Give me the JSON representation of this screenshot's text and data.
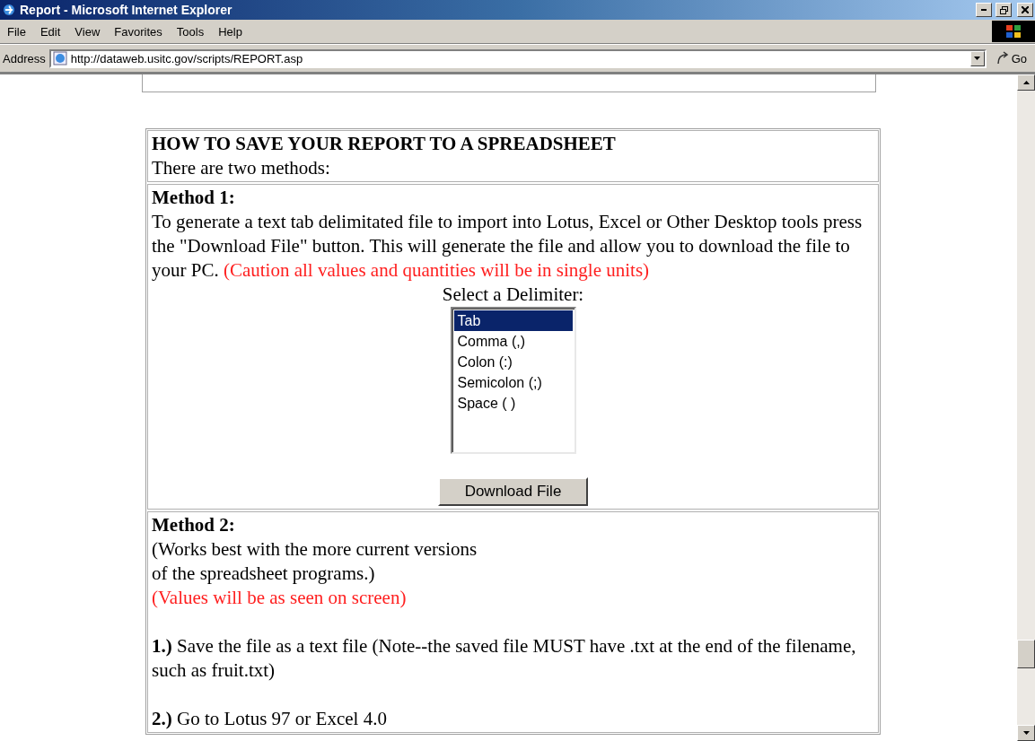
{
  "window": {
    "title": "Report - Microsoft Internet Explorer"
  },
  "menu": [
    {
      "label": "File"
    },
    {
      "label": "Edit"
    },
    {
      "label": "View"
    },
    {
      "label": "Favorites"
    },
    {
      "label": "Tools"
    },
    {
      "label": "Help"
    }
  ],
  "address": {
    "label": "Address",
    "url": "http://dataweb.usitc.gov/scripts/REPORT.asp",
    "go": "Go"
  },
  "report": {
    "heading": "HOW TO SAVE YOUR REPORT TO A SPREADSHEET",
    "intro": "There are two methods:",
    "method_1": {
      "title": "Method 1:",
      "text": "To generate a text tab delimitated file to import into Lotus, Excel or Other Desktop tools press the \"Download File\" button. This will generate the file and allow you to download the file to your PC.",
      "caution": "(Caution all values and quantities will be in single units)",
      "delimiter_label": "Select a Delimiter:",
      "delimiters": [
        {
          "label": "Tab",
          "selected": true
        },
        {
          "label": "Comma (,)",
          "selected": false
        },
        {
          "label": "Colon (:)",
          "selected": false
        },
        {
          "label": "Semicolon (;)",
          "selected": false
        },
        {
          "label": "Space ( )",
          "selected": false
        }
      ],
      "button": "Download File"
    },
    "method_2": {
      "title": "Method 2:",
      "note_lines": [
        "(Works best with the more current versions",
        "of the spreadsheet programs.)"
      ],
      "warning": "(Values will be as seen on screen)",
      "steps": [
        {
          "number": "1.)",
          "text": "Save the file as a text file (Note--the saved file MUST have .txt at the end of the filename, such as fruit.txt)"
        },
        {
          "number": "2.)",
          "text": "Go to Lotus 97 or Excel 4.0"
        }
      ]
    }
  }
}
